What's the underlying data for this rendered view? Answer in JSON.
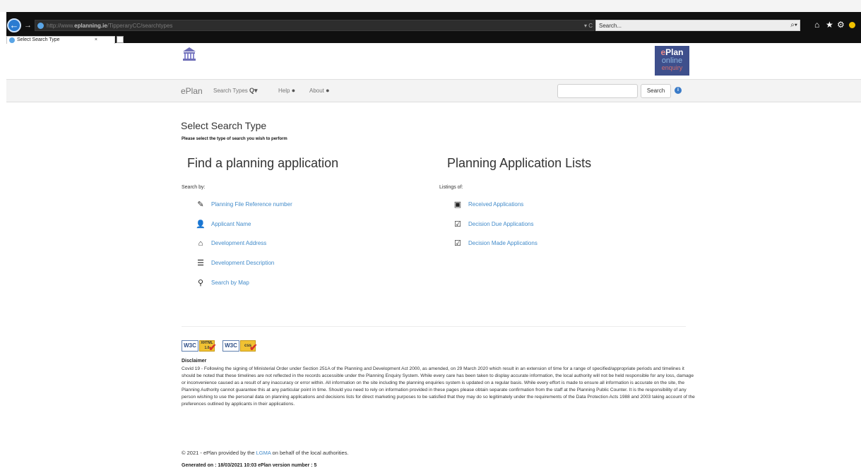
{
  "browser": {
    "address": {
      "url_prefix": "http://www.",
      "url_domain": "eplanning.ie",
      "url_path": "/TipperaryCC/searchtypes",
      "refresh_symbol": "▾ C"
    },
    "search_placeholder": "Search...",
    "search_icon": "⌕▾",
    "tab": {
      "title": "Select Search Type",
      "close": "×"
    },
    "icons": [
      "home-icon",
      "star-icon",
      "gear-icon",
      "smiley-icon"
    ]
  },
  "header": {
    "eplan_logo": {
      "line1_e": "e",
      "line1_rest": "Plan",
      "line2": "online",
      "line3": "enquiry"
    }
  },
  "navbar": {
    "brand": "ePlan",
    "search_types": "Search Types",
    "search_types_icon": "Q▾",
    "help": "Help",
    "about": "About",
    "search_button": "Search",
    "search_input_value": ""
  },
  "main": {
    "title": "Select Search Type",
    "subtitle": "Please select the type of search you wish to perform",
    "find": {
      "heading": "Find a planning application",
      "caption": "Search by:",
      "links": [
        {
          "label": "Planning File Reference number",
          "icon": "pencil-icon"
        },
        {
          "label": "Applicant Name",
          "icon": "user-icon"
        },
        {
          "label": "Development Address",
          "icon": "home-icon"
        },
        {
          "label": "Development Description",
          "icon": "list-icon"
        },
        {
          "label": "Search by Map",
          "icon": "map-marker-icon"
        }
      ]
    },
    "lists": {
      "heading": "Planning Application Lists",
      "caption": "Listings of:",
      "links": [
        {
          "label": "Received Applications",
          "icon": "inbox-icon"
        },
        {
          "label": "Decision Due Applications",
          "icon": "edit-check-icon"
        },
        {
          "label": "Decision Made Applications",
          "icon": "check-icon"
        }
      ]
    }
  },
  "footer": {
    "w3c_xhtml": {
      "w3c": "W3C",
      "tag_line1": "XHTML",
      "tag_line2": "1.0"
    },
    "w3c_css": {
      "w3c": "W3C",
      "tag": "css"
    },
    "disclaimer_title": "Disclaimer",
    "disclaimer_text": "Covid 19 - Following the signing of Ministerial Order under Section 251A of the Planning and Development Act 2000, as amended, on 29 March 2020 which result in an extension of time for a range of specified/appropriate periods and timelines it should be noted that these timelines are not reflected in the records accessible under the Planning Enquiry System. While every care has been taken to display accurate information, the local authority will not be held responsible for any loss, damage or inconvenience caused as a result of any inaccuracy or error within. All information on the site including the planning enquiries system is updated on a regular basis. While every effort is made to ensure all information is accurate on the site, the Planning Authority cannot guarantee this at any particular point in time. Should you need to rely on information provided in these pages please obtain separate confirmation from the staff at the Planning Public Counter. It is the responsibility of any person wishing to use the personal data on planning applications and decisions lists for direct marketing purposes to be satisfied that they may do so legitimately under the requirements of the Data Protection Acts 1988 and 2003 taking account of the preferences outlined by applicants in their applications.",
    "copyright_prefix": "© 2021 - ePlan provided by the",
    "copyright_link": "LGMA",
    "copyright_suffix": "on behalf of the local authorities.",
    "generated": "Generated on : 18/03/2021 10:03 ePlan version number : 5"
  }
}
